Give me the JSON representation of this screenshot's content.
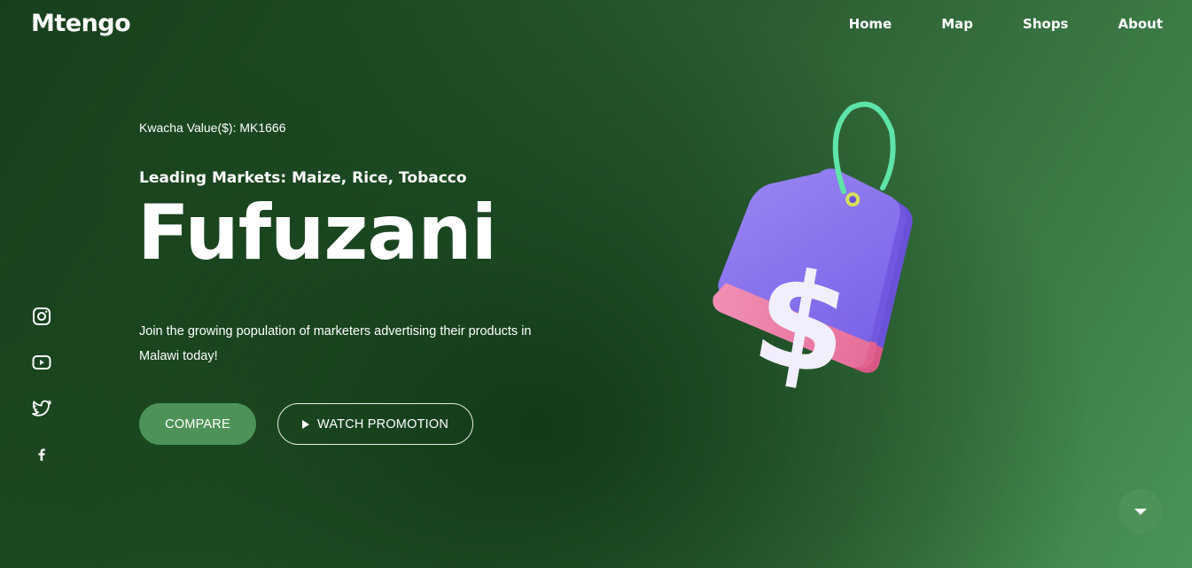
{
  "brand": {
    "logo": "Mtengo"
  },
  "nav": {
    "items": [
      "Home",
      "Map",
      "Shops",
      "About"
    ]
  },
  "hero": {
    "kwacha": "Kwacha Value($): MK1666",
    "leading": "Leading Markets: Maize, Rice, Tobacco",
    "city": "Fufuzani",
    "tagline": "Join the growing population of marketers advertising their products in Malawi today!",
    "compare_label": "COMPARE",
    "watch_label": "WATCH PROMOTION"
  },
  "illustration": {
    "symbol": "$"
  },
  "social": {
    "icons": [
      "instagram-icon",
      "youtube-icon",
      "twitter-icon",
      "facebook-icon"
    ]
  },
  "scroll": {
    "icon": "chevron-down-icon"
  },
  "colors": {
    "accent": "#4d9357",
    "tag_purple": "#8b74ef",
    "tag_pink": "#ef86ac",
    "loop_green": "#5ee4a9"
  }
}
